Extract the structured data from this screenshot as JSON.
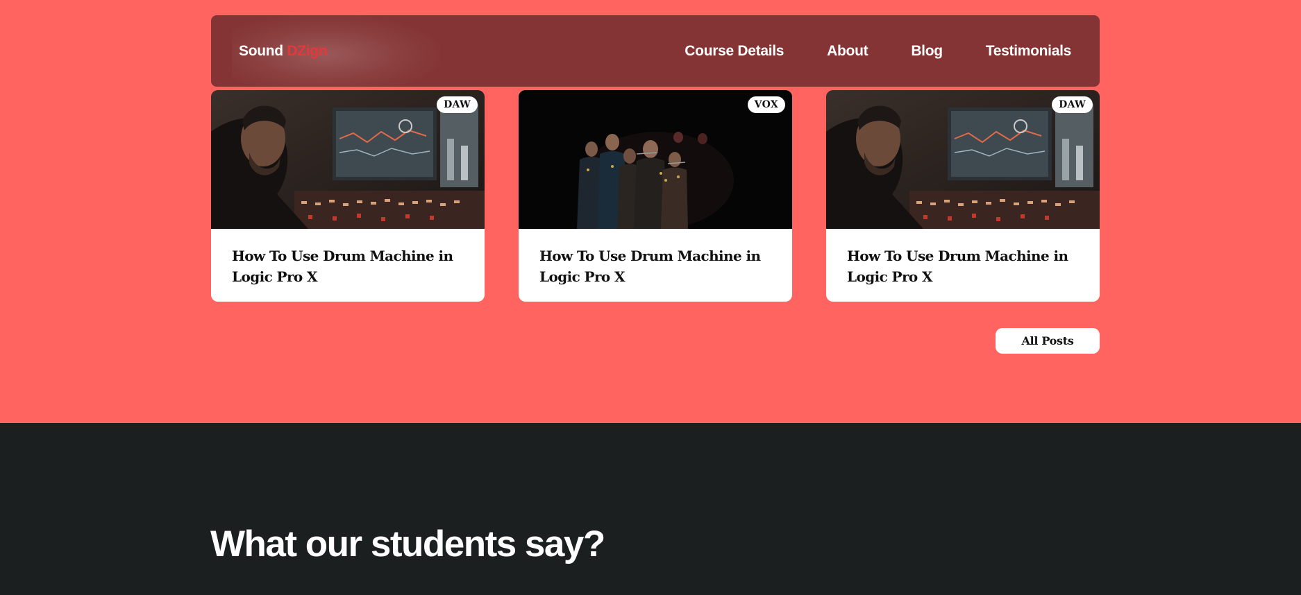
{
  "header": {
    "logo_main": "Sound",
    "logo_accent": "DZign",
    "nav": [
      {
        "label": "Course Details"
      },
      {
        "label": "About"
      },
      {
        "label": "Blog"
      },
      {
        "label": "Testimonials"
      }
    ]
  },
  "posts": [
    {
      "tag": "DAW",
      "title": "How To Use Drum Machine in Logic Pro X",
      "image": "studio-producer-photo"
    },
    {
      "tag": "VOX",
      "title": "How To Use Drum Machine in Logic Pro X",
      "image": "choir-stage-photo"
    },
    {
      "tag": "DAW",
      "title": "How To Use Drum Machine in Logic Pro X",
      "image": "studio-producer-photo"
    }
  ],
  "all_posts_label": "All Posts",
  "testimonials": {
    "heading": "What our students say?"
  },
  "colors": {
    "page_bg": "#ff6461",
    "nav_bg": "#843434",
    "accent": "#e5383b",
    "dark_bg": "#1b1f1f"
  }
}
